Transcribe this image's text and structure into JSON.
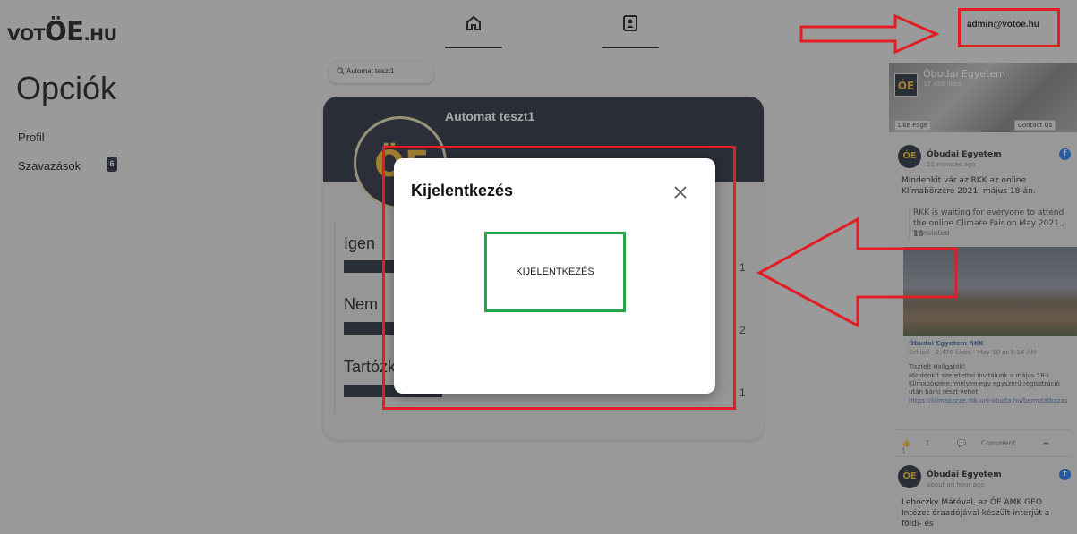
{
  "header": {
    "logo_small_1": "VOT",
    "logo_big": "ÖE",
    "logo_small_2": ".HU",
    "nav": [
      {
        "icon": "home-icon"
      },
      {
        "icon": "contact-card-icon"
      }
    ],
    "account": "admin@votoe.hu"
  },
  "sidebar": {
    "title": "Opciók",
    "items": [
      {
        "label": "Profil"
      },
      {
        "label": "Szavazások",
        "badge": "6"
      }
    ]
  },
  "main": {
    "search": {
      "value": "Automat teszt1",
      "icon": "search-icon"
    },
    "card": {
      "title": "Automat teszt1",
      "logo_text": "ÖE",
      "options": [
        {
          "label": "Igen",
          "count": "1"
        },
        {
          "label": "Nem",
          "count": "2"
        },
        {
          "label": "Tartózkodom",
          "count": "1"
        }
      ]
    }
  },
  "facebook": {
    "page_name": "Óbudai Egyetem",
    "page_likes": "17,450 likes",
    "like_button": "Like Page",
    "contact_button": "Contact Us",
    "posts": [
      {
        "author": "Óbudai Egyetem",
        "time": "21 minutes ago",
        "text": "Mindenkit vár az RKK az online Klímabörzére 2021. május 18-án.",
        "translation": "RKK is waiting for everyone to attend the online Climate Fair on May 2021., 18",
        "translated_label": "Translated",
        "shared_source": "Óbudai Egyetem RKK",
        "shared_meta": "School · 2,470 Likes · May 10 at 8:14 AM",
        "shared_greeting": "Tisztelt Hallgatók!",
        "shared_text": "Mindenkit szeretettel invitálunk a május 18-i Klímabörzére, melyen egy egyszerű regisztráció után bárki részt vehet:",
        "shared_link": "https://klimaborze.rkk.uni-obuda.hu/bemutatkozas",
        "likes": "1",
        "comment_label": "Comment",
        "shares": "1"
      },
      {
        "author": "Óbudai Egyetem",
        "time": "about an hour ago",
        "text": "Lehoczky Mátéval, az ÓE AMK GEO Intézet óraadójával készült interjút a földi- és"
      }
    ]
  },
  "modal": {
    "title": "Kijelentkezés",
    "close_icon": "close-icon",
    "button": "KIJELENTKEZÉS"
  },
  "colors": {
    "navy": "#1c2333",
    "gold": "#f0b728",
    "annotation_red": "#e21d23",
    "annotation_green": "#22a447"
  }
}
